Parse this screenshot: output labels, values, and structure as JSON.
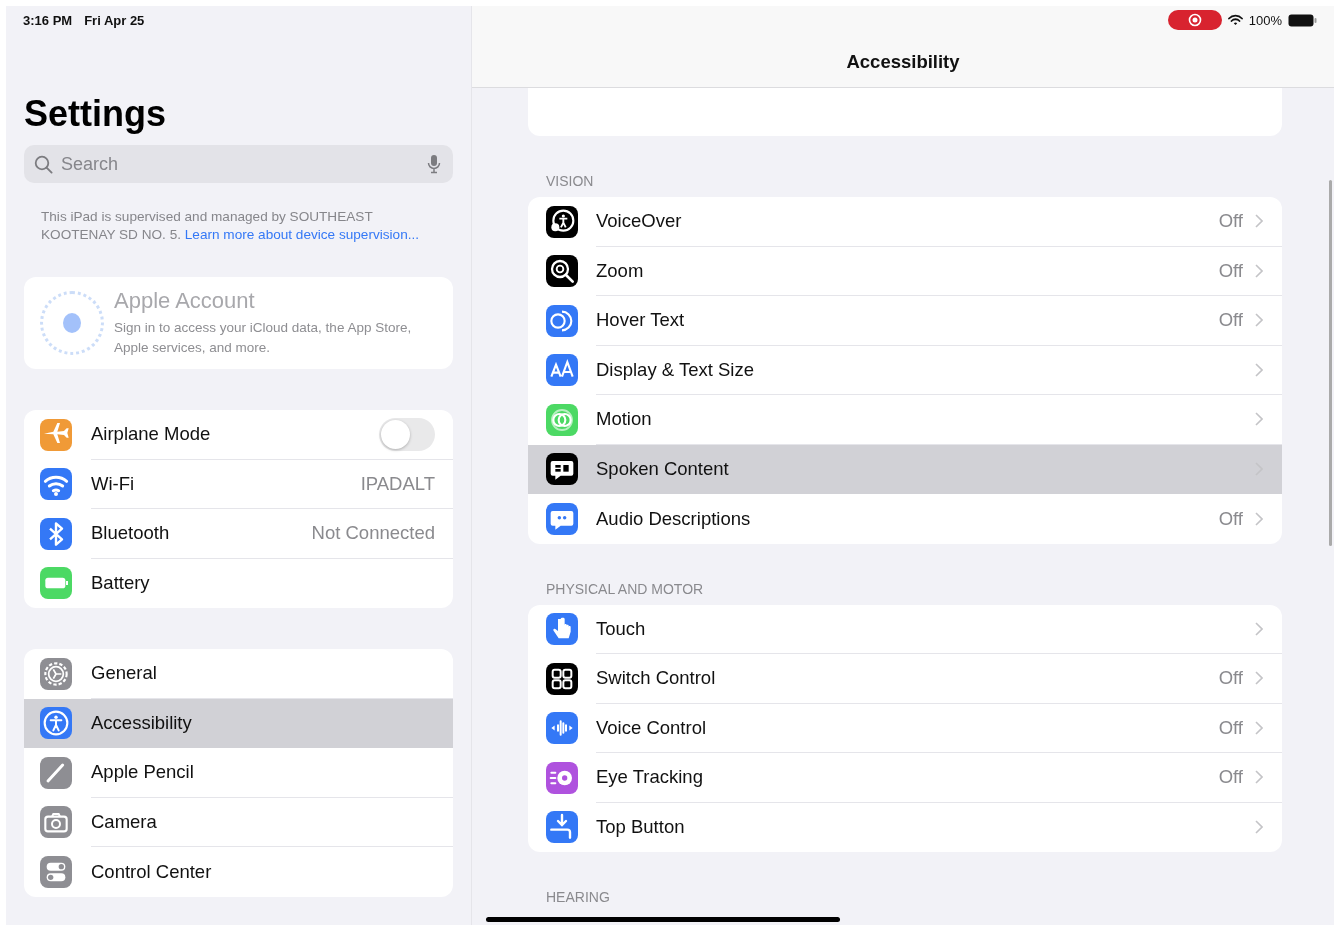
{
  "status_bar": {
    "time": "3:16 PM",
    "date": "Fri Apr 25",
    "recording": true,
    "battery": "100%"
  },
  "sidebar": {
    "title": "Settings",
    "search": {
      "placeholder": "Search"
    },
    "supervision_note": {
      "text": "This iPad is supervised and managed by SOUTHEAST KOOTENAY SD NO. 5.",
      "link": "Learn more about device supervision..."
    },
    "account": {
      "title": "Apple Account",
      "subtitle": "Sign in to access your iCloud data, the App Store, Apple services, and more.",
      "disabled": true
    },
    "groups": [
      {
        "items": [
          {
            "label": "Airplane Mode",
            "color": "#f09a37",
            "kind": "toggle",
            "on": false,
            "selected": false
          },
          {
            "label": "Wi-Fi",
            "color": "#3478f6",
            "kind": "value",
            "value": "IPADALT",
            "selected": false
          },
          {
            "label": "Bluetooth",
            "color": "#3478f6",
            "kind": "value",
            "value": "Not Connected",
            "selected": false
          },
          {
            "label": "Battery",
            "color": "#4cd964",
            "kind": "plain",
            "selected": false
          }
        ]
      },
      {
        "items": [
          {
            "label": "General",
            "color": "#8e8e93",
            "kind": "plain",
            "selected": false
          },
          {
            "label": "Accessibility",
            "color": "#3478f6",
            "kind": "plain",
            "selected": true
          },
          {
            "label": "Apple Pencil",
            "color": "#8e8e93",
            "kind": "plain",
            "selected": false
          },
          {
            "label": "Camera",
            "color": "#8e8e93",
            "kind": "plain",
            "selected": false
          },
          {
            "label": "Control Center",
            "color": "#8e8e93",
            "kind": "plain",
            "selected": false
          }
        ]
      }
    ]
  },
  "detail": {
    "title": "Accessibility",
    "sections": [
      {
        "header": "VISION",
        "items": [
          {
            "label": "VoiceOver",
            "color": "#000000",
            "value": "Off",
            "selected": false
          },
          {
            "label": "Zoom",
            "color": "#000000",
            "value": "Off",
            "selected": false
          },
          {
            "label": "Hover Text",
            "color": "#3478f6",
            "value": "Off",
            "selected": false
          },
          {
            "label": "Display & Text Size",
            "color": "#3478f6",
            "selected": false
          },
          {
            "label": "Motion",
            "color": "#4cd964",
            "selected": false
          },
          {
            "label": "Spoken Content",
            "color": "#000000",
            "selected": true
          },
          {
            "label": "Audio Descriptions",
            "color": "#3478f6",
            "value": "Off",
            "selected": false
          }
        ]
      },
      {
        "header": "PHYSICAL AND MOTOR",
        "items": [
          {
            "label": "Touch",
            "color": "#3478f6",
            "selected": false
          },
          {
            "label": "Switch Control",
            "color": "#000000",
            "value": "Off",
            "selected": false
          },
          {
            "label": "Voice Control",
            "color": "#3478f6",
            "value": "Off",
            "selected": false
          },
          {
            "label": "Eye Tracking",
            "color": "#af52de",
            "value": "Off",
            "selected": false
          },
          {
            "label": "Top Button",
            "color": "#3478f6",
            "selected": false
          }
        ]
      },
      {
        "header": "HEARING"
      }
    ]
  }
}
